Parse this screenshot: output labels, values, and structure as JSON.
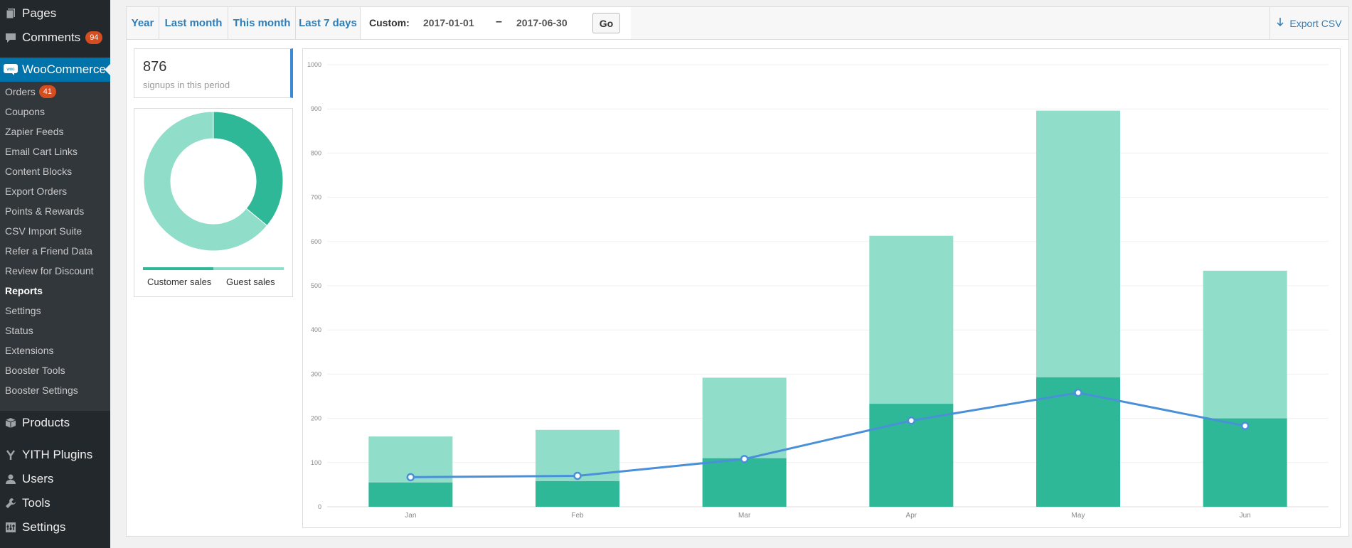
{
  "sidebar": {
    "pages_label": "Pages",
    "comments_label": "Comments",
    "comments_badge": "94",
    "woocommerce_label": "WooCommerce",
    "submenu": [
      {
        "label": "Orders",
        "badge": "41"
      },
      {
        "label": "Coupons"
      },
      {
        "label": "Zapier Feeds"
      },
      {
        "label": "Email Cart Links"
      },
      {
        "label": "Content Blocks"
      },
      {
        "label": "Export Orders"
      },
      {
        "label": "Points & Rewards"
      },
      {
        "label": "CSV Import Suite"
      },
      {
        "label": "Refer a Friend Data"
      },
      {
        "label": "Review for Discount"
      },
      {
        "label": "Reports",
        "current": true
      },
      {
        "label": "Settings"
      },
      {
        "label": "Status"
      },
      {
        "label": "Extensions"
      },
      {
        "label": "Booster Tools"
      },
      {
        "label": "Booster Settings"
      }
    ],
    "products_label": "Products",
    "yith_label": "YITH Plugins",
    "users_label": "Users",
    "tools_label": "Tools",
    "settings_label": "Settings"
  },
  "tabs": {
    "year": "Year",
    "last_month": "Last month",
    "this_month": "This month",
    "last_7_days": "Last 7 days",
    "custom_label": "Custom:",
    "date_from": "2017-01-01",
    "date_sep": "–",
    "date_to": "2017-06-30",
    "go": "Go",
    "export": "Export CSV"
  },
  "summary": {
    "signups_count": "876",
    "signups_label": "signups in this period"
  },
  "donut": {
    "customer_label": "Customer sales",
    "guest_label": "Guest sales",
    "customer_fraction": 0.36,
    "customer_color": "#2eb897",
    "guest_color": "#90ddc9"
  },
  "chart_data": {
    "type": "bar",
    "categories": [
      "Jan",
      "Feb",
      "Mar",
      "Apr",
      "May",
      "Jun"
    ],
    "series": [
      {
        "name": "Customer sales",
        "type": "bar",
        "color": "#2eb897",
        "values": [
          55,
          58,
          110,
          233,
          293,
          200
        ]
      },
      {
        "name": "Guest sales",
        "type": "bar",
        "color": "#90ddc9",
        "values": [
          104,
          116,
          182,
          380,
          603,
          334
        ]
      },
      {
        "name": "Signups",
        "type": "line",
        "color": "#4a90d9",
        "values": [
          67,
          70,
          108,
          195,
          258,
          183
        ]
      }
    ],
    "stacked": true,
    "ylim": [
      0,
      1000
    ],
    "yticks": [
      0,
      100,
      200,
      300,
      400,
      500,
      600,
      700,
      800,
      900,
      1000
    ],
    "grid": true
  }
}
